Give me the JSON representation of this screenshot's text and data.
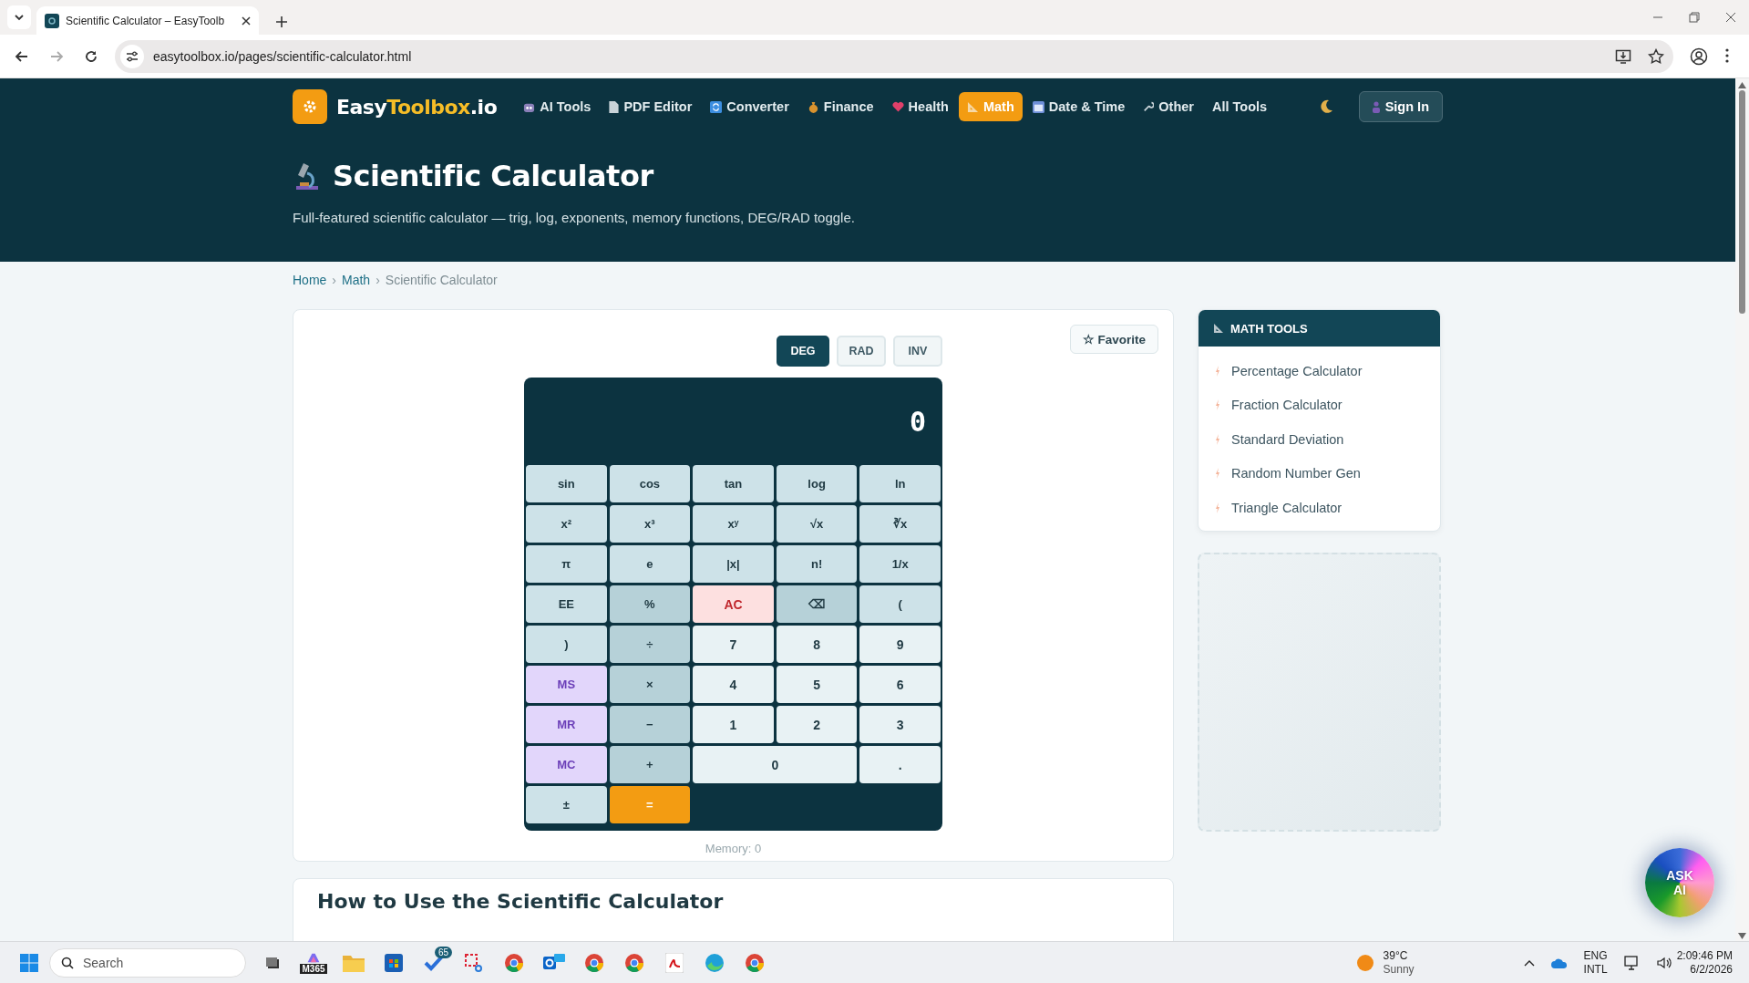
{
  "browser": {
    "tab_title": "Scientific Calculator – EasyToolb",
    "url": "easytoolbox.io/pages/scientific-calculator.html"
  },
  "site_header": {
    "logo": [
      {
        "text": "Easy",
        "highlight": false
      },
      {
        "text": "Toolbox",
        "highlight": true
      },
      {
        "text": ".io",
        "highlight": false
      }
    ],
    "nav": [
      {
        "label": "AI Tools",
        "selected": false
      },
      {
        "label": "PDF Editor",
        "selected": false
      },
      {
        "label": "Converter",
        "selected": false
      },
      {
        "label": "Finance",
        "selected": false
      },
      {
        "label": "Health",
        "selected": false
      },
      {
        "label": "Math",
        "selected": true
      },
      {
        "label": "Date & Time",
        "selected": false
      },
      {
        "label": "Other",
        "selected": false
      },
      {
        "label": "All Tools",
        "selected": false
      }
    ],
    "sign_in": "Sign In"
  },
  "hero": {
    "title": "Scientific Calculator",
    "subtitle": "Full-featured scientific calculator — trig, log, exponents, memory functions, DEG/RAD toggle."
  },
  "breadcrumb": [
    {
      "text": "Home",
      "kind": "link"
    },
    {
      "text": "›",
      "kind": "separator"
    },
    {
      "text": "Math",
      "kind": "link"
    },
    {
      "text": "›",
      "kind": "separator"
    },
    {
      "text": "Scientific Calculator",
      "kind": "current"
    }
  ],
  "calculator": {
    "favorite": "☆ Favorite",
    "modes": [
      {
        "label": "DEG",
        "selected": true
      },
      {
        "label": "RAD",
        "selected": false
      },
      {
        "label": "INV",
        "selected": false
      }
    ],
    "display": "0",
    "buttons": [
      {
        "label": "sin",
        "kind": "fn",
        "wide": false
      },
      {
        "label": "cos",
        "kind": "fn",
        "wide": false
      },
      {
        "label": "tan",
        "kind": "fn",
        "wide": false
      },
      {
        "label": "log",
        "kind": "fn",
        "wide": false
      },
      {
        "label": "ln",
        "kind": "fn",
        "wide": false
      },
      {
        "label": "x²",
        "kind": "fn",
        "wide": false
      },
      {
        "label": "x³",
        "kind": "fn",
        "wide": false
      },
      {
        "label": "xʸ",
        "kind": "fn",
        "wide": false
      },
      {
        "label": "√x",
        "kind": "fn",
        "wide": false
      },
      {
        "label": "∛x",
        "kind": "fn",
        "wide": false
      },
      {
        "label": "π",
        "kind": "fn",
        "wide": false
      },
      {
        "label": "e",
        "kind": "fn",
        "wide": false
      },
      {
        "label": "|x|",
        "kind": "fn",
        "wide": false
      },
      {
        "label": "n!",
        "kind": "fn",
        "wide": false
      },
      {
        "label": "1/x",
        "kind": "fn",
        "wide": false
      },
      {
        "label": "EE",
        "kind": "fn",
        "wide": false
      },
      {
        "label": "%",
        "kind": "op",
        "wide": false
      },
      {
        "label": "AC",
        "kind": "clear",
        "wide": false
      },
      {
        "label": "⌫",
        "kind": "op",
        "wide": false
      },
      {
        "label": "(",
        "kind": "fn",
        "wide": false
      },
      {
        "label": ")",
        "kind": "fn",
        "wide": false
      },
      {
        "label": "÷",
        "kind": "op",
        "wide": false
      },
      {
        "label": "7",
        "kind": "num",
        "wide": false
      },
      {
        "label": "8",
        "kind": "num",
        "wide": false
      },
      {
        "label": "9",
        "kind": "num",
        "wide": false
      },
      {
        "label": "MS",
        "kind": "mem",
        "wide": false
      },
      {
        "label": "×",
        "kind": "op",
        "wide": false
      },
      {
        "label": "4",
        "kind": "num",
        "wide": false
      },
      {
        "label": "5",
        "kind": "num",
        "wide": false
      },
      {
        "label": "6",
        "kind": "num",
        "wide": false
      },
      {
        "label": "MR",
        "kind": "mem",
        "wide": false
      },
      {
        "label": "−",
        "kind": "op",
        "wide": false
      },
      {
        "label": "1",
        "kind": "num",
        "wide": false
      },
      {
        "label": "2",
        "kind": "num",
        "wide": false
      },
      {
        "label": "3",
        "kind": "num",
        "wide": false
      },
      {
        "label": "MC",
        "kind": "mem",
        "wide": false
      },
      {
        "label": "+",
        "kind": "op",
        "wide": false
      },
      {
        "label": "0",
        "kind": "num",
        "wide": true
      },
      {
        "label": ".",
        "kind": "num",
        "wide": false
      },
      {
        "label": "±",
        "kind": "fn",
        "wide": false
      },
      {
        "label": "=",
        "kind": "equals",
        "wide": false
      }
    ],
    "memory": "Memory: 0"
  },
  "sidebar": {
    "title": "MATH TOOLS",
    "items": [
      "Percentage Calculator",
      "Fraction Calculator",
      "Standard Deviation",
      "Random Number Gen",
      "Triangle Calculator"
    ]
  },
  "section": {
    "heading": "How to Use the Scientific Calculator"
  },
  "ask_ai": "ASK AI",
  "taskbar": {
    "search": "Search",
    "m365": "M365",
    "badge": "65",
    "weather": {
      "temp": "39°C",
      "condition": "Sunny"
    },
    "language": "ENG",
    "layout": "INTL",
    "time": "2:09:46 PM",
    "date": "6/2/2026"
  }
}
